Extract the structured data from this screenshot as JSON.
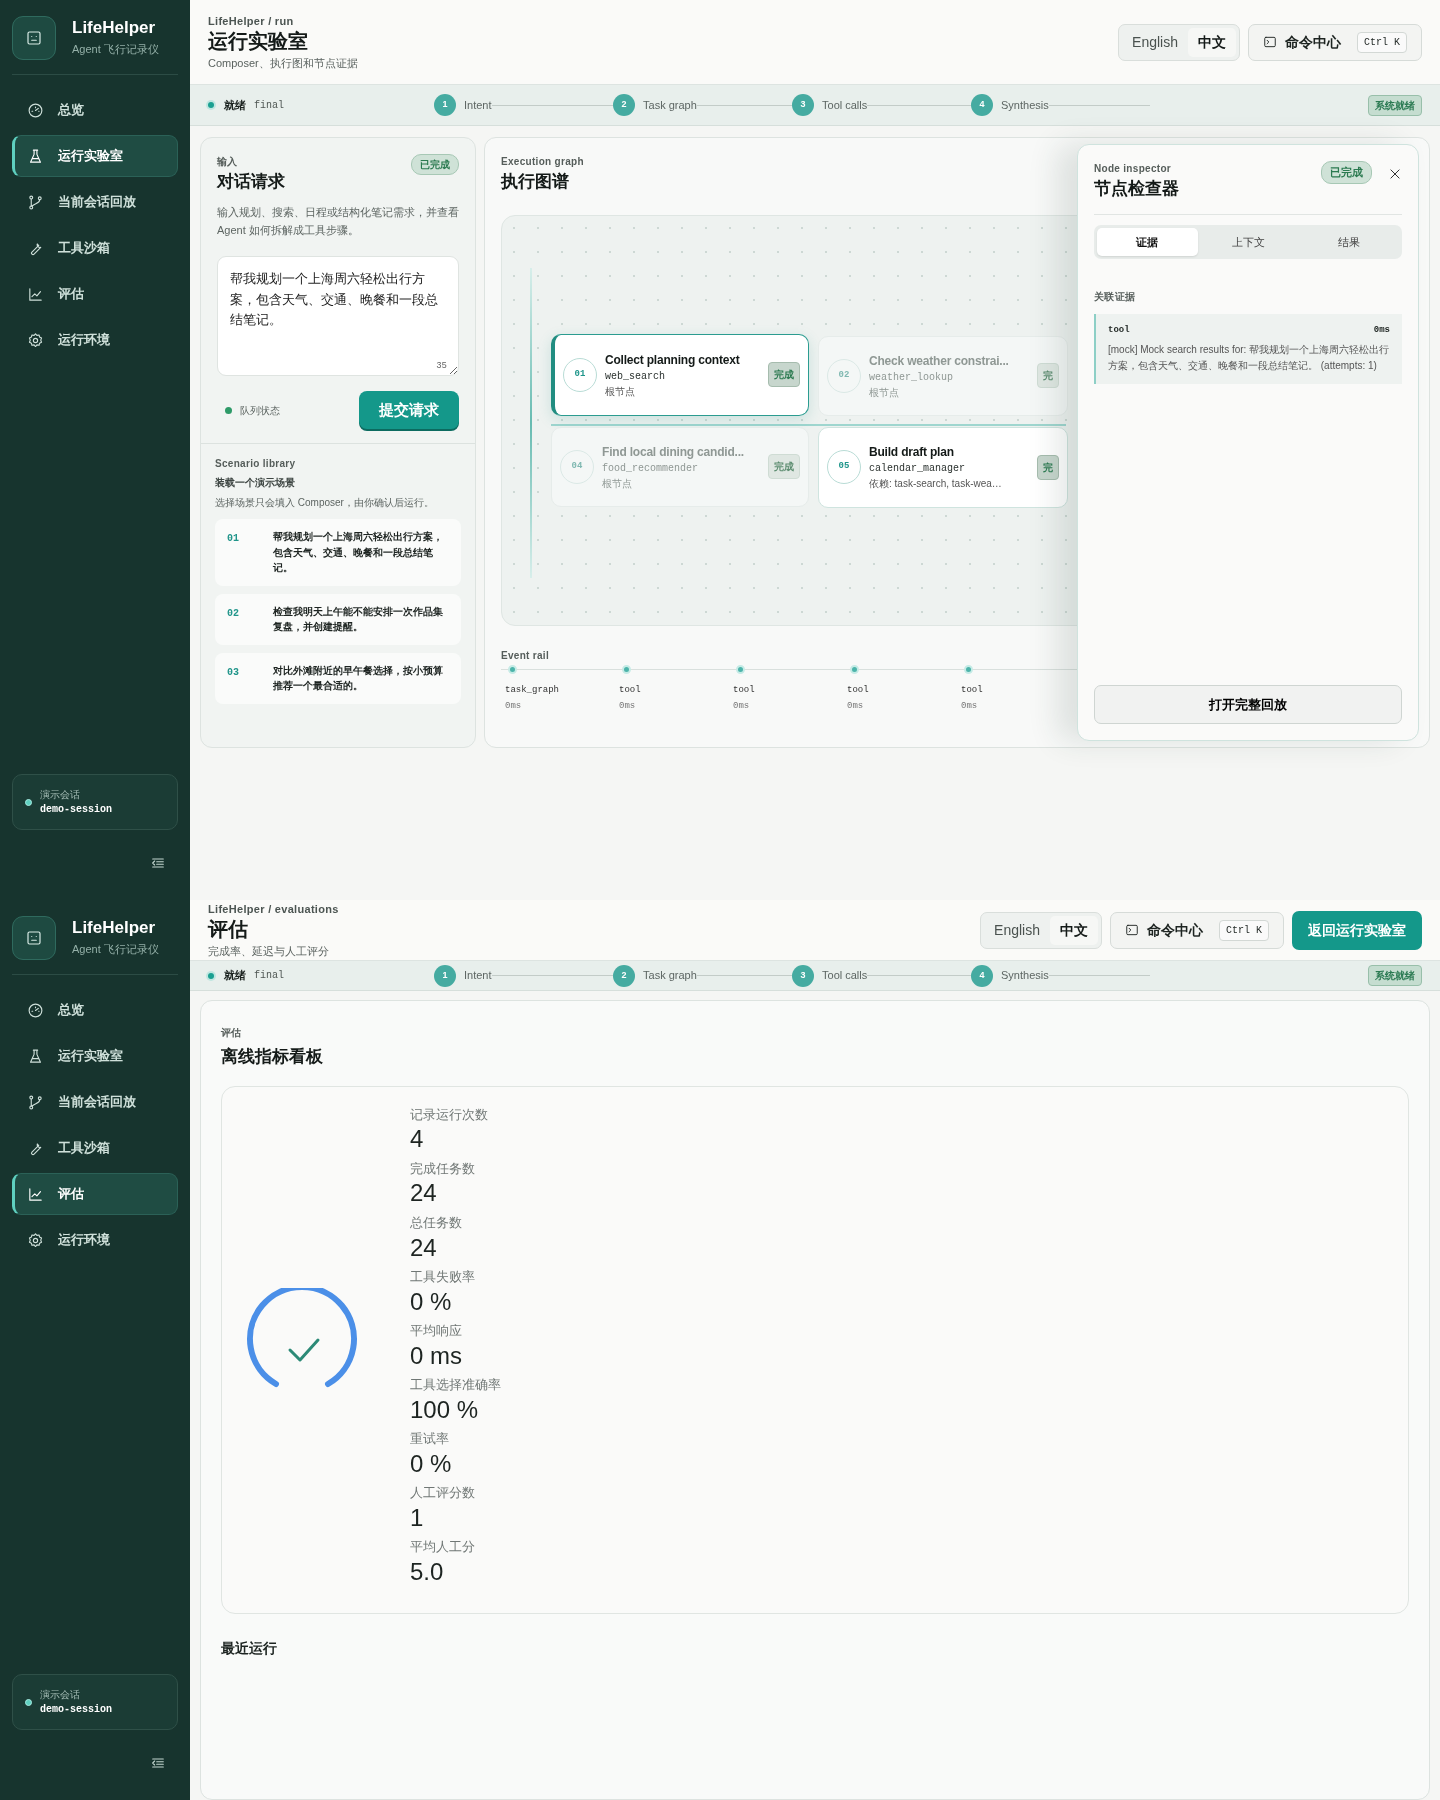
{
  "screens": [
    {
      "kind": "run",
      "sidebar": {
        "brand": "LifeHelper",
        "tagline": "Agent 飞行记录仪",
        "items": [
          {
            "label": "总览",
            "selected": false
          },
          {
            "label": "运行实验室",
            "selected": true
          },
          {
            "label": "当前会话回放",
            "selected": false
          },
          {
            "label": "工具沙箱",
            "selected": false
          },
          {
            "label": "评估",
            "selected": false
          },
          {
            "label": "运行环境",
            "selected": false
          }
        ],
        "session": {
          "label": "演示会话",
          "value": "demo-session"
        }
      },
      "header": {
        "breadcrumb": "LifeHelper / run",
        "title": "运行实验室",
        "subtitle": "Composer、执行图和节点证据",
        "languages": [
          {
            "label": "English",
            "selected": false
          },
          {
            "label": "中文",
            "selected": true
          }
        ],
        "command": {
          "label": "命令中心",
          "shortcut": "Ctrl K"
        }
      },
      "status_bar": {
        "state": "就绪",
        "phase": "final",
        "steps": [
          {
            "number": "1",
            "label": "Intent"
          },
          {
            "number": "2",
            "label": "Task graph"
          },
          {
            "number": "3",
            "label": "Tool calls"
          },
          {
            "number": "4",
            "label": "Synthesis"
          }
        ],
        "badge": "系统就绪"
      },
      "composer": {
        "eyebrow": "输入",
        "title": "对话请求",
        "badge": "已完成",
        "description": "输入规划、搜索、日程或结构化笔记需求，并查看 Agent 如何拆解成工具步骤。",
        "value": "帮我规划一个上海周六轻松出行方案，包含天气、交通、晚餐和一段总结笔记。",
        "count": "35",
        "queue_status": "队列状态",
        "submit": "提交请求"
      },
      "scenarios": {
        "eyebrow": "Scenario library",
        "title": "装载一个演示场景",
        "description": "选择场景只会填入 Composer，由你确认后运行。",
        "items": [
          {
            "number": "01",
            "text": "帮我规划一个上海周六轻松出行方案，包含天气、交通、晚餐和一段总结笔记。"
          },
          {
            "number": "02",
            "text": "检查我明天上午能不能安排一次作品集复盘，并创建提醒。"
          },
          {
            "number": "03",
            "text": "对比外滩附近的早午餐选择，按小预算推荐一个最合适的。"
          }
        ]
      },
      "graph": {
        "eyebrow": "Execution graph",
        "title": "执行图谱",
        "nodes": [
          {
            "number": "01",
            "title": "Collect planning context",
            "tool": "web_search",
            "meta": "根节点",
            "badge": "完成",
            "selected": true,
            "dimmed": false
          },
          {
            "number": "02",
            "title": "Check weather constrai...",
            "tool": "weather_lookup",
            "meta": "根节点",
            "badge": "完",
            "selected": false,
            "dimmed": true
          },
          {
            "number": "04",
            "title": "Find local dining candid...",
            "tool": "food_recommender",
            "meta": "根节点",
            "badge": "完成",
            "selected": false,
            "dimmed": true
          },
          {
            "number": "05",
            "title": "Build draft plan",
            "tool": "calendar_manager",
            "meta": "依赖: task-search, task-wea…",
            "badge": "完",
            "selected": false,
            "dimmed": false
          }
        ],
        "event_rail": {
          "label": "Event rail",
          "events": [
            {
              "type": "task_graph",
              "time": "0ms"
            },
            {
              "type": "tool",
              "time": "0ms"
            },
            {
              "type": "tool",
              "time": "0ms"
            },
            {
              "type": "tool",
              "time": "0ms"
            },
            {
              "type": "tool",
              "time": "0ms"
            }
          ]
        }
      },
      "inspector": {
        "eyebrow": "Node inspector",
        "title": "节点检查器",
        "badge": "已完成",
        "tabs": [
          {
            "label": "证据",
            "selected": true
          },
          {
            "label": "上下文",
            "selected": false
          },
          {
            "label": "结果",
            "selected": false
          }
        ],
        "section": "关联证据",
        "evidence": {
          "type": "tool",
          "time": "0ms",
          "text": "[mock] Mock search results for: 帮我规划一个上海周六轻松出行方案，包含天气、交通、晚餐和一段总结笔记。 (attempts: 1)"
        },
        "button": "打开完整回放"
      }
    },
    {
      "kind": "evaluations",
      "sidebar": {
        "brand": "LifeHelper",
        "tagline": "Agent 飞行记录仪",
        "items": [
          {
            "label": "总览",
            "selected": false
          },
          {
            "label": "运行实验室",
            "selected": false
          },
          {
            "label": "当前会话回放",
            "selected": false
          },
          {
            "label": "工具沙箱",
            "selected": false
          },
          {
            "label": "评估",
            "selected": true
          },
          {
            "label": "运行环境",
            "selected": false
          }
        ],
        "session": {
          "label": "演示会话",
          "value": "demo-session"
        }
      },
      "header": {
        "breadcrumb": "LifeHelper / evaluations",
        "title": "评估",
        "subtitle": "完成率、延迟与人工评分",
        "languages": [
          {
            "label": "English",
            "selected": false
          },
          {
            "label": "中文",
            "selected": true
          }
        ],
        "command": {
          "label": "命令中心",
          "shortcut": "Ctrl K"
        },
        "primary_button": "返回运行实验室"
      },
      "status_bar": {
        "state": "就绪",
        "phase": "final",
        "steps": [
          {
            "number": "1",
            "label": "Intent"
          },
          {
            "number": "2",
            "label": "Task graph"
          },
          {
            "number": "3",
            "label": "Tool calls"
          },
          {
            "number": "4",
            "label": "Synthesis"
          }
        ],
        "badge": "系统就绪"
      },
      "evaluation": {
        "eyebrow": "评估",
        "title": "离线指标看板",
        "metrics": [
          {
            "label": "记录运行次数",
            "value": "4"
          },
          {
            "label": "完成任务数",
            "value": "24"
          },
          {
            "label": "总任务数",
            "value": "24"
          },
          {
            "label": "工具失败率",
            "value": "0 %"
          },
          {
            "label": "平均响应",
            "value": "0 ms"
          },
          {
            "label": "工具选择准确率",
            "value": "100 %"
          },
          {
            "label": "重试率",
            "value": "0 %"
          },
          {
            "label": "人工评分数",
            "value": "1"
          },
          {
            "label": "平均人工分",
            "value": "5.0"
          }
        ],
        "recent_title": "最近运行"
      }
    }
  ]
}
